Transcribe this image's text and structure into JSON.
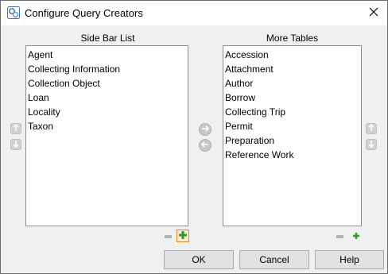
{
  "window": {
    "title": "Configure Query Creators",
    "app_icon": "sp-app-icon",
    "close_icon": "close-icon"
  },
  "left_panel": {
    "title": "Side Bar List",
    "items": [
      "Agent",
      "Collecting Information",
      "Collection Object",
      "Loan",
      "Locality",
      "Taxon"
    ]
  },
  "right_panel": {
    "title": "More Tables",
    "items": [
      "Accession",
      "Attachment",
      "Author",
      "Borrow",
      "Collecting Trip",
      "Permit",
      "Preparation",
      "Reference Work"
    ]
  },
  "buttons": {
    "ok": "OK",
    "cancel": "Cancel",
    "help": "Help"
  },
  "colors": {
    "plus_green": "#2c9a2c",
    "focus_orange": "#e08a2e",
    "button_face": "#e1e1e1"
  }
}
